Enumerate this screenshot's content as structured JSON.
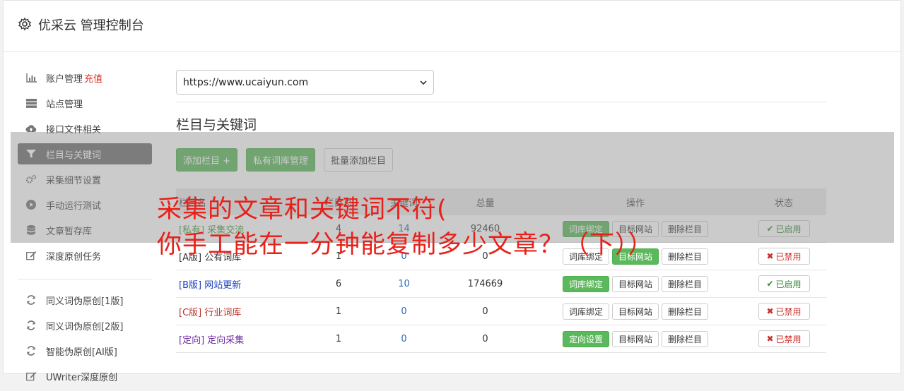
{
  "header": {
    "title": "优采云 管理控制台",
    "icon": "gear-icon"
  },
  "sidebar": {
    "items": [
      {
        "label": "账户管理",
        "extra": "充值",
        "icon": "bar-chart-icon"
      },
      {
        "label": "站点管理",
        "icon": "server-icon"
      },
      {
        "label": "接口文件相关",
        "icon": "cloud-upload-icon"
      },
      {
        "label": "栏目与关键词",
        "icon": "filter-icon",
        "active": true
      },
      {
        "label": "采集细节设置",
        "icon": "cogs-icon"
      },
      {
        "label": "手动运行测试",
        "icon": "play-circle-icon"
      },
      {
        "label": "文章暂存库",
        "icon": "database-icon"
      },
      {
        "label": "深度原创任务",
        "icon": "edit-icon"
      }
    ],
    "items2": [
      {
        "label": "同义词伪原创[1版]",
        "icon": "refresh-icon"
      },
      {
        "label": "同义词伪原创[2版]",
        "icon": "refresh-icon"
      },
      {
        "label": "智能伪原创[AI版]",
        "icon": "refresh-icon"
      },
      {
        "label": "UWriter深度原创",
        "icon": "edit-icon"
      }
    ]
  },
  "main": {
    "site_select": "https://www.ucaiyun.com",
    "section_title": "栏目与关键词",
    "buttons": {
      "add_column": "添加栏目 +",
      "private_lib": "私有词库管理",
      "batch_add": "批量添加栏目"
    },
    "table": {
      "headers": {
        "name": "栏目名",
        "a": "栏目总",
        "b": "关键词",
        "c": "总量",
        "ops": "操作",
        "state": "状态"
      },
      "rows": [
        {
          "tag": "[私有]",
          "name": "采集交流",
          "a": "4",
          "b": "14",
          "c": "92460",
          "op1": "词库绑定",
          "op1_green": true,
          "op2": "目标网站",
          "op2_green": false,
          "op3": "删除栏目",
          "state": "已启用",
          "enabled": true,
          "color": "#4a9b3c"
        },
        {
          "tag": "[A版]",
          "name": "公有词库",
          "a": "1",
          "b": "0",
          "c": "0",
          "op1": "词库绑定",
          "op1_green": false,
          "op2": "目标网站",
          "op2_green": true,
          "op3": "删除栏目",
          "state": "已禁用",
          "enabled": false,
          "color": "#333333"
        },
        {
          "tag": "[B版]",
          "name": "网站更新",
          "a": "6",
          "b": "10",
          "c": "174669",
          "op1": "词库绑定",
          "op1_green": true,
          "op2": "目标网站",
          "op2_green": false,
          "op3": "删除栏目",
          "state": "已启用",
          "enabled": true,
          "color": "#1a3fc4"
        },
        {
          "tag": "[C版]",
          "name": "行业词库",
          "a": "1",
          "b": "0",
          "c": "0",
          "op1": "词库绑定",
          "op1_green": false,
          "op2": "目标网站",
          "op2_green": false,
          "op3": "删除栏目",
          "state": "已禁用",
          "enabled": false,
          "color": "#b5342b"
        },
        {
          "tag": "[定向]",
          "name": "定向采集",
          "a": "1",
          "b": "0",
          "c": "0",
          "op1": "定向设置",
          "op1_green": true,
          "op2": "目标网站",
          "op2_green": false,
          "op3": "删除栏目",
          "state": "已禁用",
          "enabled": false,
          "color": "#6a2ba0"
        }
      ]
    }
  },
  "overlay": {
    "line1": "采集的文章和关键词不符(",
    "line2": "你手工能在一分钟能复制多少文章？（下））"
  },
  "colors": {
    "green": "#5cb85c",
    "red": "#e0302b",
    "overlay_text": "#e8201a"
  }
}
